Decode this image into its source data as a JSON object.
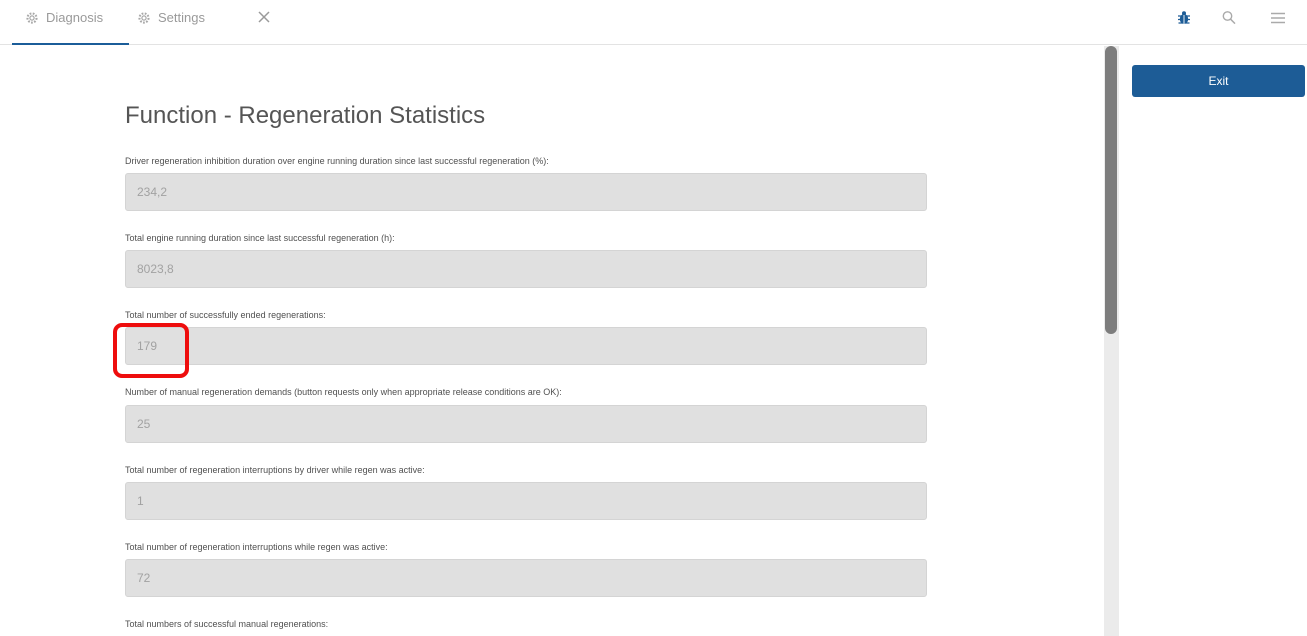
{
  "tabs": [
    {
      "label": "Diagnosis",
      "icon": "gear-icon",
      "active": true
    },
    {
      "label": "Settings",
      "icon": "gear-icon",
      "active": false
    }
  ],
  "header_icons": [
    "close-icon",
    "bug-icon",
    "search-icon",
    "menu-icon"
  ],
  "page": {
    "title": "Function - Regeneration Statistics",
    "fields": [
      {
        "label": "Driver regeneration inhibition duration over engine running duration since last successful regeneration (%):",
        "value": "234,2"
      },
      {
        "label": "Total engine running duration since last successful regeneration (h):",
        "value": "8023,8"
      },
      {
        "label": "Total number of successfully ended regenerations:",
        "value": "179"
      },
      {
        "label": "Number of manual regeneration demands (button requests only when appropriate release conditions are OK):",
        "value": "25"
      },
      {
        "label": "Total number of regeneration interruptions by driver while regen was active:",
        "value": "1"
      },
      {
        "label": "Total number of regeneration interruptions while regen was active:",
        "value": "72"
      },
      {
        "label": "Total numbers of successful manual regenerations:",
        "value": ""
      }
    ]
  },
  "sidebar": {
    "exit_label": "Exit"
  },
  "colors": {
    "accent": "#1d5c96",
    "highlight": "#ee0d0d",
    "field_bg": "#e0e0e0"
  }
}
